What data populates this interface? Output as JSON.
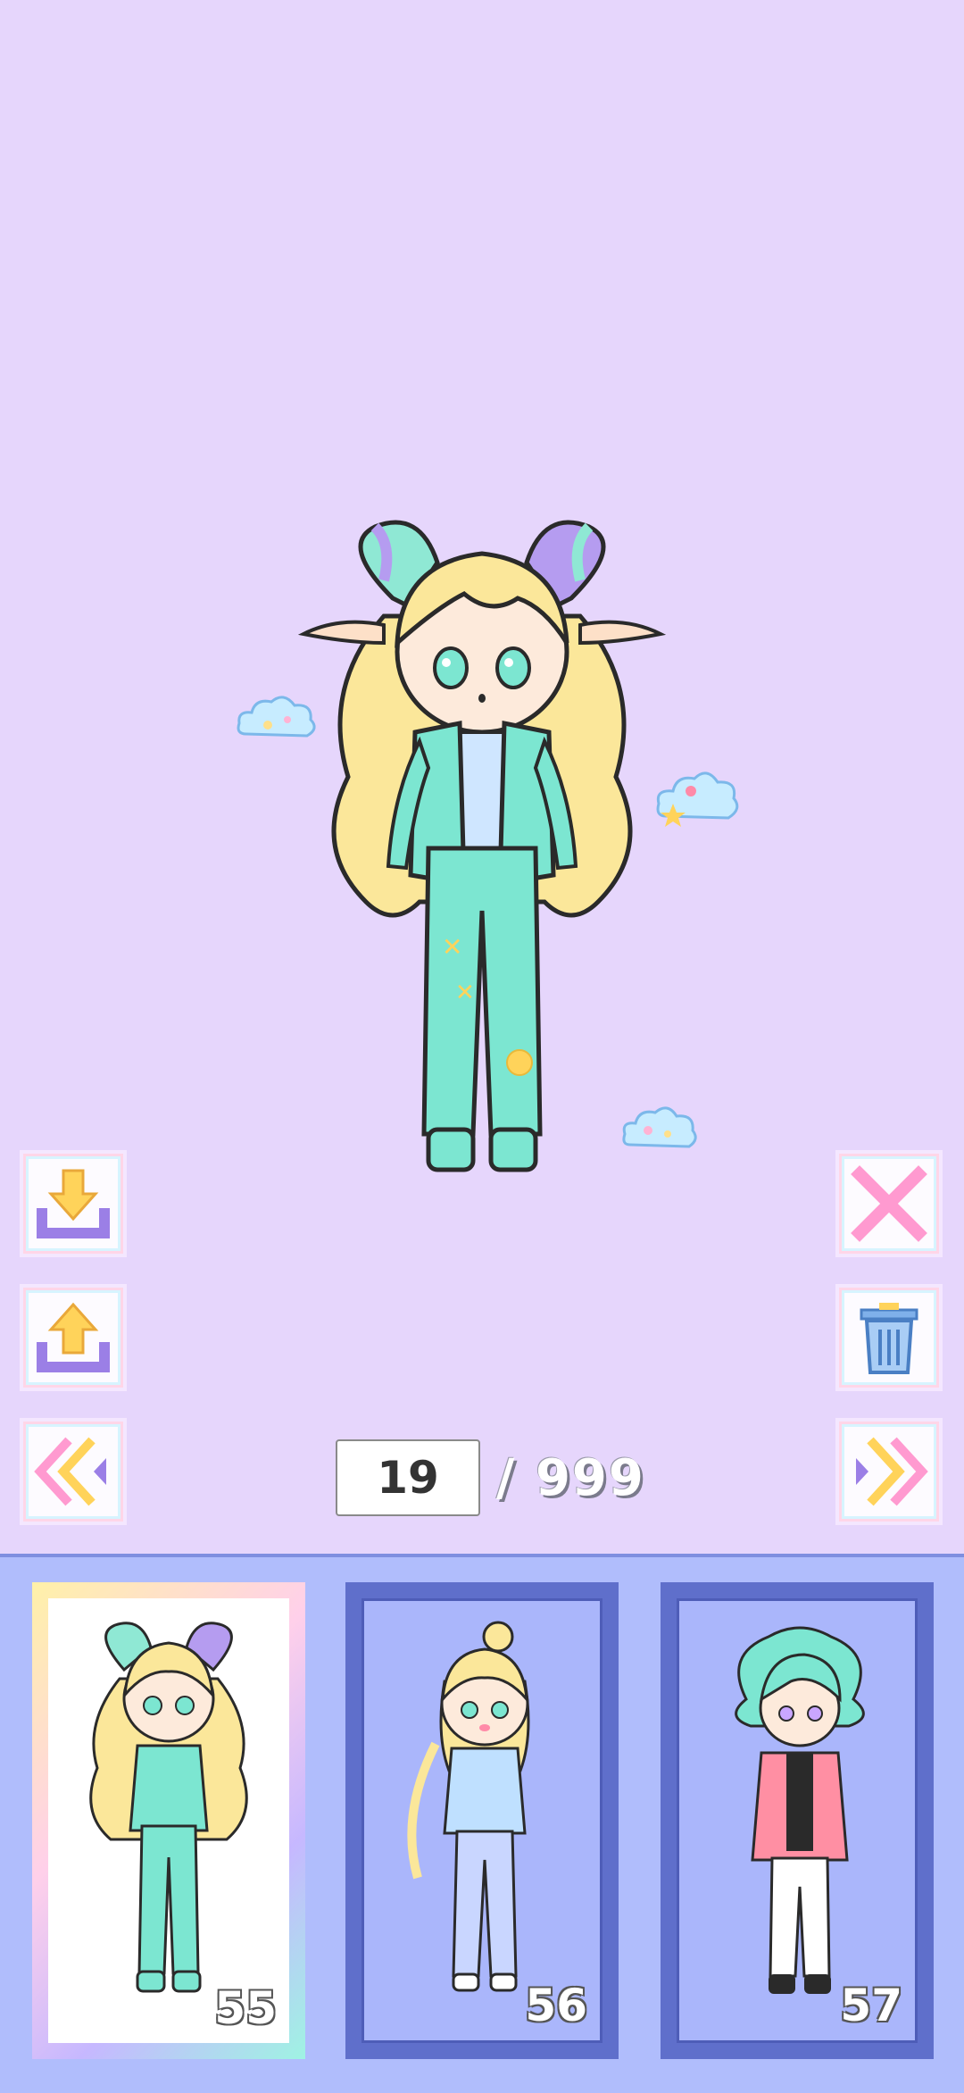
{
  "pager": {
    "current": "19",
    "total": "/ 999"
  },
  "side_buttons": {
    "left": [
      "download-icon",
      "upload-icon",
      "previous-page-icon"
    ],
    "right": [
      "close-icon",
      "trash-icon",
      "next-page-icon"
    ]
  },
  "slots": [
    {
      "number": "55",
      "selected": true
    },
    {
      "number": "56",
      "selected": false
    },
    {
      "number": "57",
      "selected": false
    }
  ],
  "colors": {
    "background": "#e6d6fc",
    "tray": "#b0bdfc",
    "card_frame": "#5f6fcb",
    "hair_blonde": "#fbe79a",
    "outfit_mint": "#7ce6d1",
    "horn_purple": "#b59cf0"
  }
}
